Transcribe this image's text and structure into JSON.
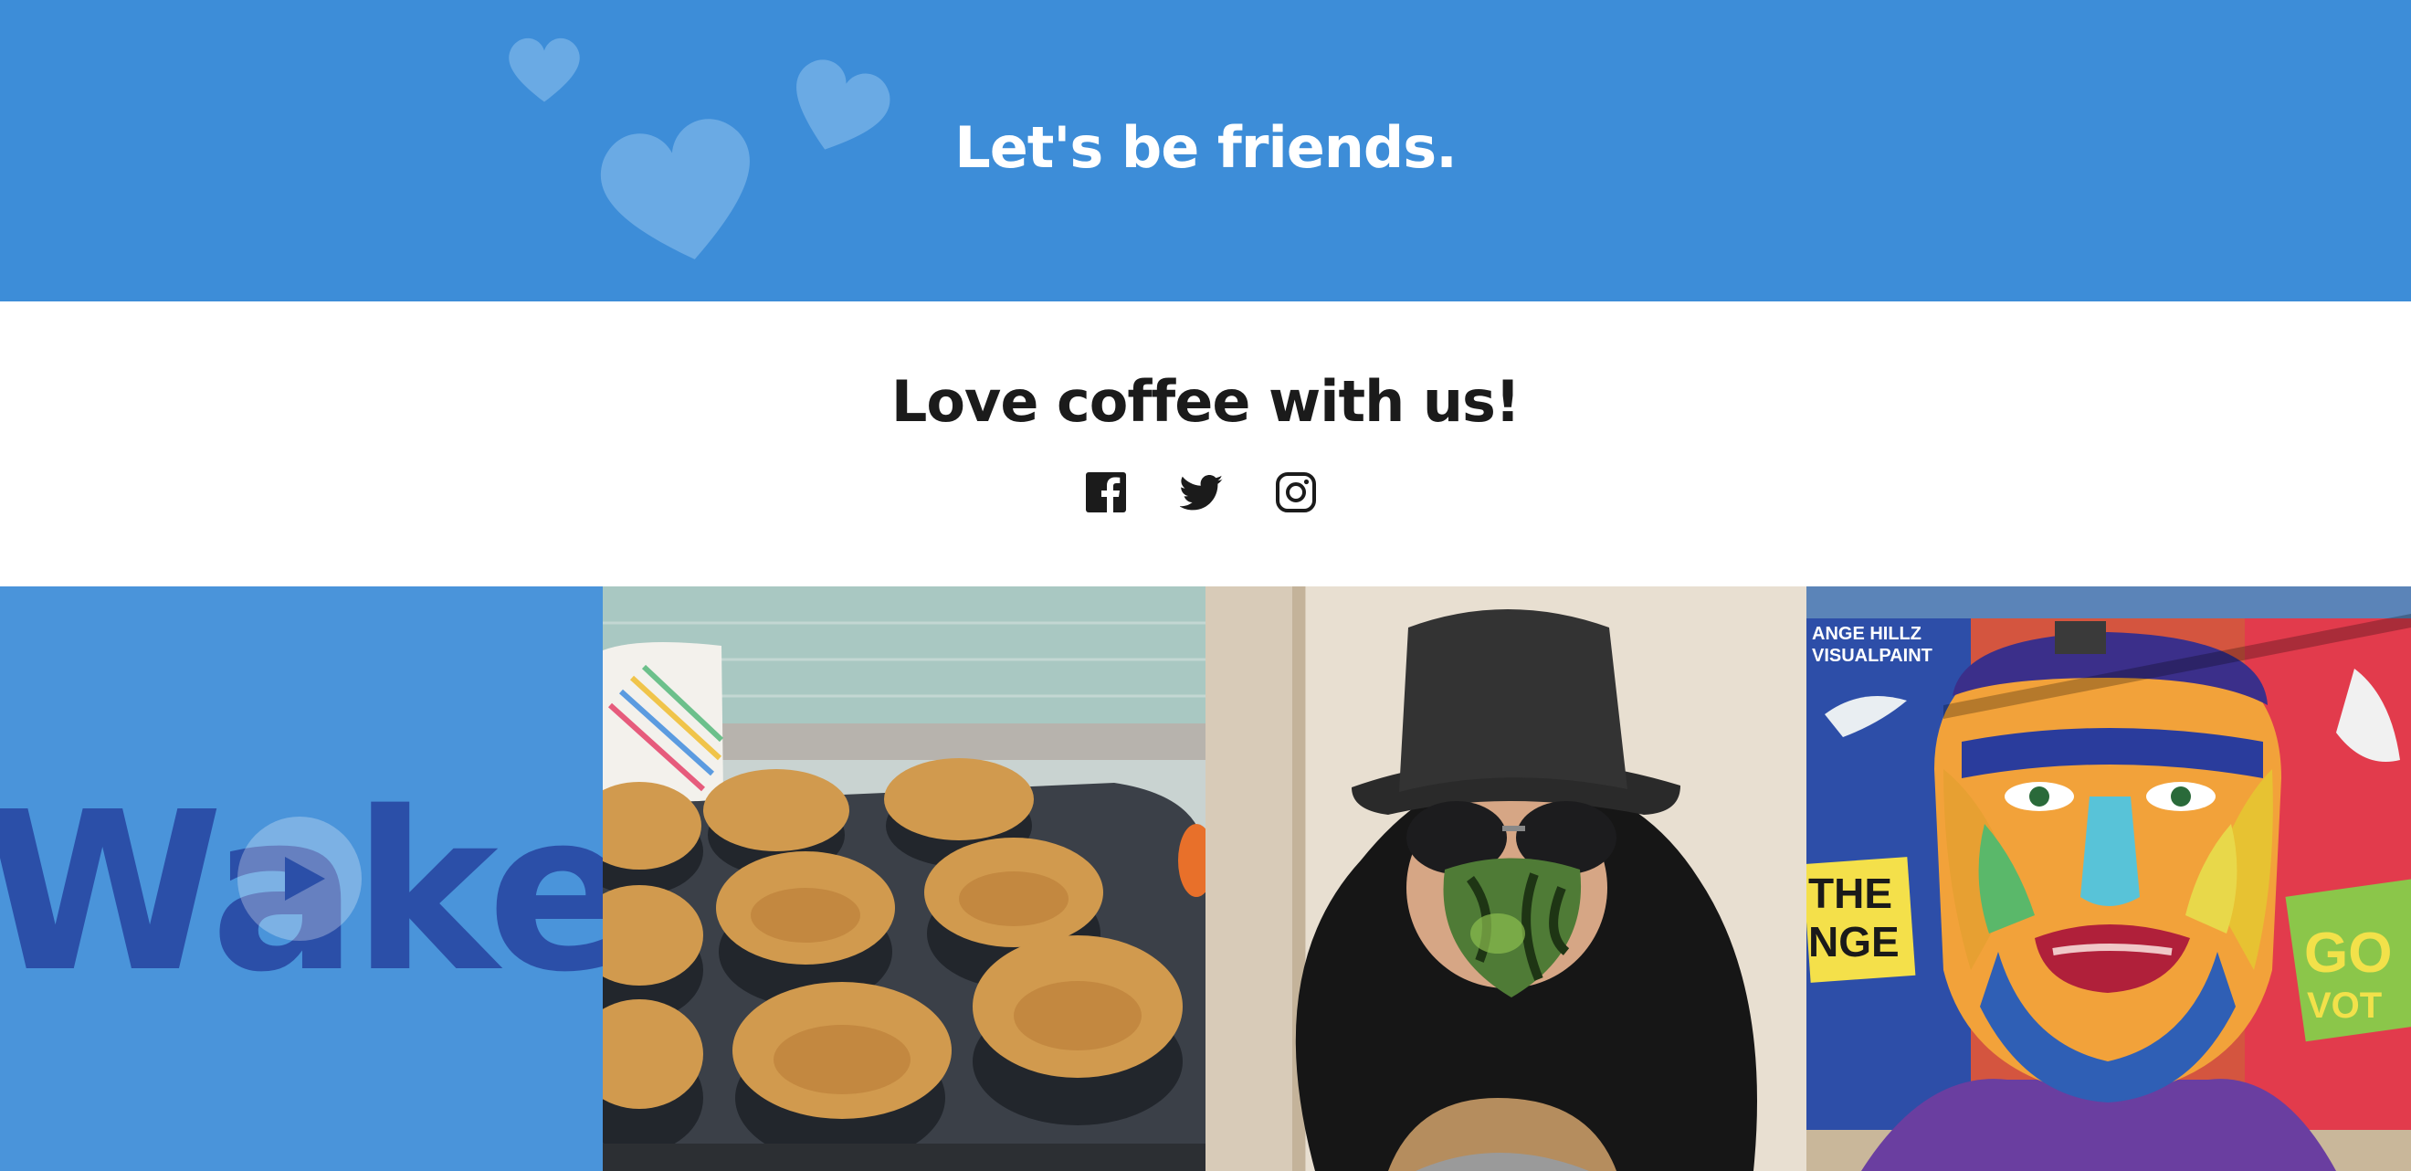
{
  "banner": {
    "title": "Let's be friends.",
    "background_color": "#3d8dd8",
    "decoration": "heart-icon"
  },
  "social": {
    "title": "Love coffee with us!",
    "icons": [
      "facebook-icon",
      "twitter-icon",
      "instagram-icon"
    ]
  },
  "gallery": {
    "tiles": [
      {
        "kind": "video",
        "overlay_text": "Wake",
        "icon": "play-icon"
      },
      {
        "kind": "photo",
        "subject": "muffins"
      },
      {
        "kind": "photo",
        "subject": "selfie"
      },
      {
        "kind": "photo",
        "subject": "mural"
      }
    ],
    "mural_text": {
      "artist_line1": "ANGE HILLZ",
      "artist_line2": "VISUALPAINT",
      "sign_left_1": "THE",
      "sign_left_2": "NGE",
      "sign_right_1": "GO",
      "sign_right_2": "VOT"
    }
  }
}
